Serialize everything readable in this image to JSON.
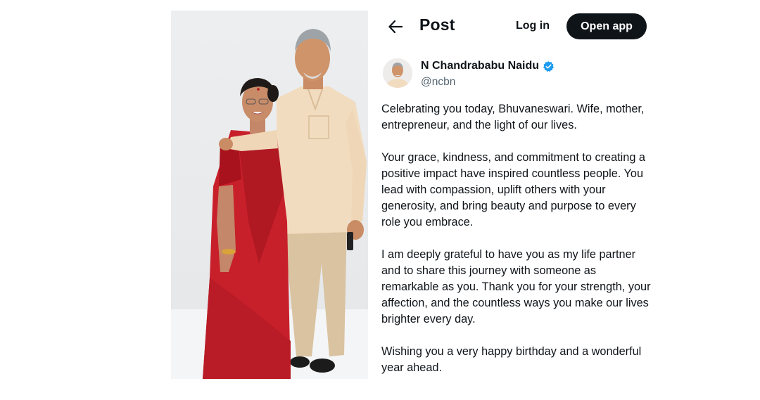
{
  "header": {
    "back_icon": "arrow-left-icon",
    "title": "Post",
    "login_label": "Log in",
    "open_app_label": "Open app"
  },
  "author": {
    "name": "N Chandrababu Naidu",
    "handle": "@ncbn",
    "verified_icon": "verified-badge-icon",
    "verified_color": "#1d9bf0"
  },
  "post": {
    "paragraphs": [
      "Celebrating you today, Bhuvaneswari. Wife, mother, entrepreneur, and the light of our lives.",
      "Your grace, kindness, and commitment to creating a positive impact have inspired countless people. You lead with compassion, uplift others with your generosity, and bring beauty and purpose to every role you embrace.",
      "I am deeply grateful to have you as my life partner and to share this journey with someone as remarkable as you. Thank you for your strength, your affection, and the countless ways you make our lives brighter every day.",
      "Wishing you a very happy birthday and a wonderful year ahead."
    ]
  },
  "colors": {
    "text": "#0f1419",
    "secondary": "#536471",
    "button_dark": "#0f1419",
    "saree_red": "#c8202b",
    "kurta_cream": "#f2dcc0"
  }
}
